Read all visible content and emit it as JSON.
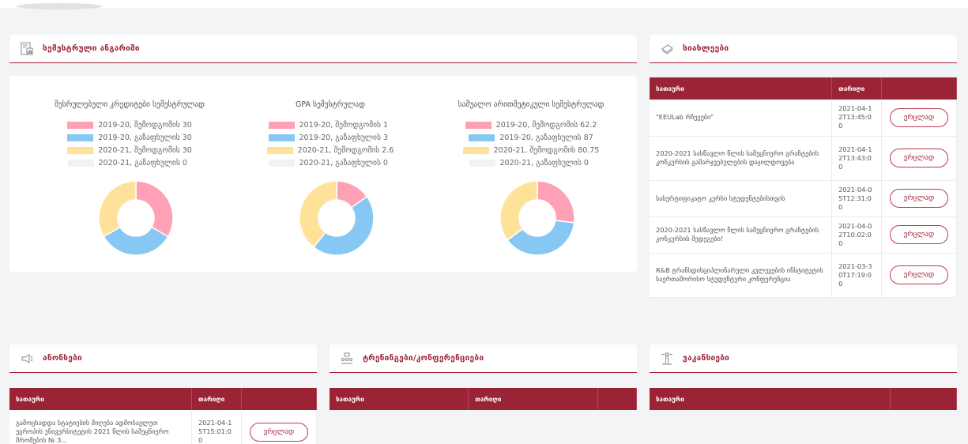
{
  "semester_report": {
    "title": "სემესტრული ანგარიში",
    "charts": [
      {
        "title": "შესრულებული კრედიტები სემესტრულად",
        "legend": [
          "2019-20, შემოდგომის 30",
          "2019-20, გაზაფხულის 30",
          "2020-21, შემოდგომის 30",
          "2020-21, გაზაფხულის 0"
        ],
        "values": [
          30,
          30,
          30,
          0
        ]
      },
      {
        "title": "GPA სემესტრულად",
        "legend": [
          "2019-20, შემოდგომის 1",
          "2019-20, გაზაფხულის 3",
          "2020-21, შემოდგომის 2.6",
          "2020-21, გაზაფხულის 0"
        ],
        "values": [
          1,
          3,
          2.6,
          0
        ]
      },
      {
        "title": "საშუალო არითმეტიკული სემესტრულად",
        "legend": [
          "2019-20, შემოდგომის 62.2",
          "2019-20, გაზაფხულის 87",
          "2020-21, შემოდგომის 80.75",
          "2020-21, გაზაფხულის 0"
        ],
        "values": [
          62.2,
          87,
          80.75,
          0
        ]
      }
    ],
    "colors": [
      "#ffa1b5",
      "#86c7f3",
      "#ffe29a",
      "#f1f2f4"
    ]
  },
  "news": {
    "title": "სიახლეები",
    "col_title": "სათაური",
    "col_date": "თარიღი",
    "button": "ვრცლად",
    "rows": [
      {
        "title": "\"EEULab რჩევები\"",
        "date": "2021-04-12T13:45:00"
      },
      {
        "title": "2020-2021 სასწავლო წლის სამეცნიერო გრანტების კონკურსის გამარჯვებულების დაჯილდოვება",
        "date": "2021-04-12T13:43:00"
      },
      {
        "title": "სასერტიფიკატო კურსი სტუდენტებისთვის",
        "date": "2021-04-05T12:31:00"
      },
      {
        "title": "2020-2021 სასწავლო წლის სამეცნიერო გრანტების კონკურსის შედეგები!",
        "date": "2021-04-02T10:02:00"
      },
      {
        "title": "R&B ტრანსდისციპლინარული კვლევების ინსტიტუტის საერთაშორისო სტუდენტური კონფერენცია",
        "date": "2021-03-30T17:19:00"
      }
    ]
  },
  "announcements": {
    "title": "ანონსები",
    "col_title": "სათაური",
    "col_date": "თარიღი",
    "button": "ვრცლად",
    "rows": [
      {
        "title": "გამოცხადდა სტატიების მიღება ადმოსავლეთ ევროპის უნივერსიტეტის 2021 წლის სამეცნიერო შრომების № 3...",
        "date": "2021-04-15T15:01:00"
      }
    ]
  },
  "trainings": {
    "title": "ტრენინგები/კონფერენციები",
    "col_title": "სათაური",
    "col_date": "თარიღი"
  },
  "vacancies": {
    "title": "ვაკანსიები",
    "col_title": "სათაური"
  }
}
